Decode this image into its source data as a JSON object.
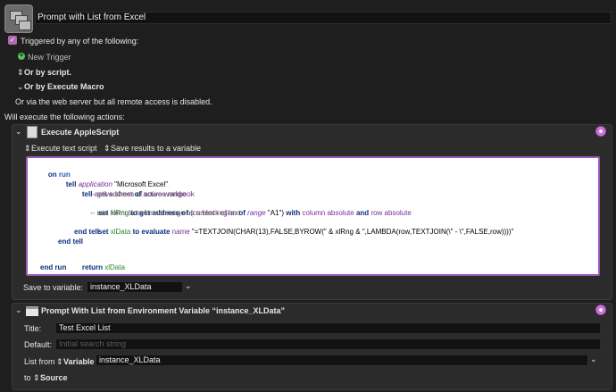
{
  "macro": {
    "title": "Prompt with List from Excel"
  },
  "triggers": {
    "triggered_label": "Triggered by any of the following:",
    "new_trigger": "New Trigger",
    "or_by_script": "Or by script.",
    "or_by_execute": "Or by Execute Macro",
    "web_server_note": "Or via the web server but all remote access is disabled.",
    "will_execute": "Will execute the following actions:"
  },
  "action1": {
    "title": "Execute AppleScript",
    "execute_option": "Execute text script",
    "results_option": "Save results to a variable",
    "save_label": "Save to variable:",
    "save_value": "instance_XLData",
    "code": {
      "l1_kw": "on",
      "l1_b": "run",
      "l2_kw": "tell",
      "l2_cls": "application",
      "l2_str": "\"Microsoft Excel\"",
      "l3_kw": "tell",
      "l3_p1": "active sheet",
      "l3_of": "of",
      "l3_p2": "active workbook",
      "l4": "-- get address of source range",
      "l5_kw": "set",
      "l5_var": "xlRng",
      "l5_to": "to",
      "l5_get": "get address of",
      "l5_p": "(current region",
      "l5_of": "of",
      "l5_cls": "range",
      "l5_s": "\"A1\")",
      "l5_with": "with",
      "l5_p2": "column absolute",
      "l5_and": "and",
      "l5_p3": "row absolute",
      "l6": "-- use formula to format range as a block of text",
      "l7_kw": "set",
      "l7_var": "xlData",
      "l7_to": "to",
      "l7_eval": "evaluate",
      "l7_name": "name",
      "l7_s": "\"=TEXTJOIN(CHAR(13),FALSE,BYROW(\" & xlRng & \",LAMBDA(row,TEXTJOIN(\\\" - \\\",FALSE,row))))\"",
      "l8": "end tell",
      "l9": "end tell",
      "l10_kw": "return",
      "l10_var": "xlData",
      "l11": "end run"
    }
  },
  "action2": {
    "title": "Prompt With List from Environment Variable “instance_XLData”",
    "title_label": "Title:",
    "title_value": "Test Excel List",
    "default_label": "Default:",
    "default_placeholder": "Initial search string",
    "list_from_label": "List from",
    "list_from_option": "Variable",
    "list_from_value": "instance_XLData",
    "to_label": "to",
    "to_option": "Source"
  },
  "colors": {
    "accent": "#b06ab3",
    "background": "#1e1e1e"
  }
}
